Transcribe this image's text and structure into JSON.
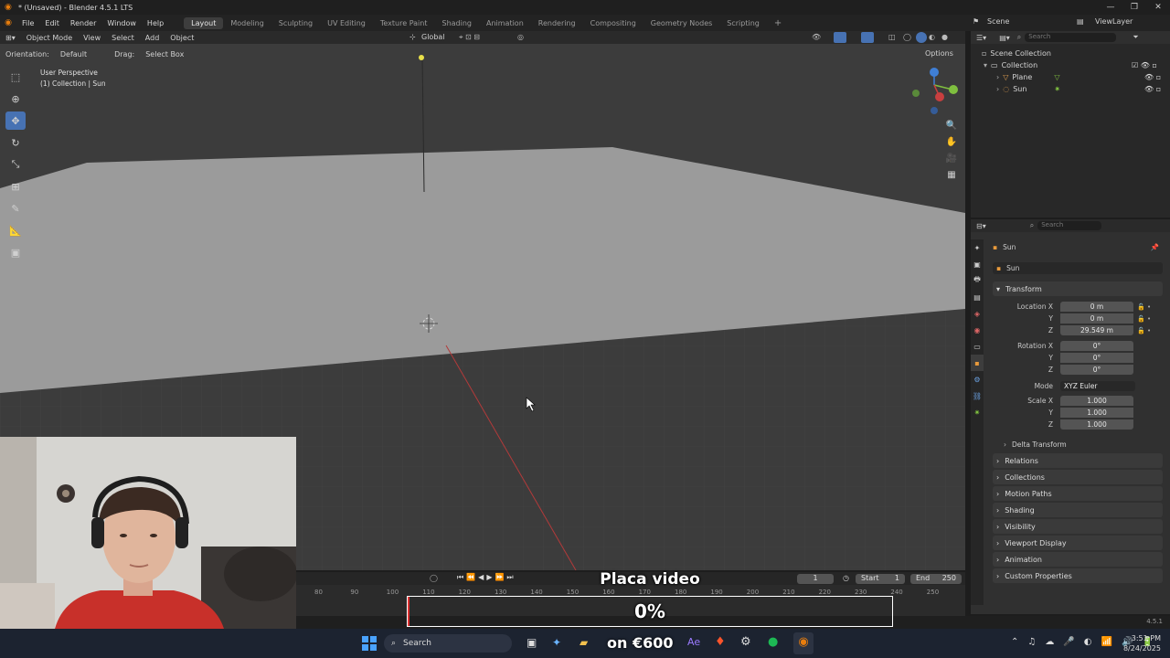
{
  "window": {
    "title": "* (Unsaved) - Blender 4.5.1 LTS",
    "minimize": "—",
    "restore": "❐",
    "close": "✕"
  },
  "menu": {
    "items": [
      "File",
      "Edit",
      "Render",
      "Window",
      "Help"
    ]
  },
  "workspaces": {
    "tabs": [
      "Layout",
      "Modeling",
      "Sculpting",
      "UV Editing",
      "Texture Paint",
      "Shading",
      "Animation",
      "Rendering",
      "Compositing",
      "Geometry Nodes",
      "Scripting"
    ],
    "active": "Layout",
    "add": "+"
  },
  "scene": {
    "label": "Scene",
    "viewlayer": "ViewLayer"
  },
  "viewport_header": {
    "mode": "Object Mode",
    "menus": [
      "View",
      "Select",
      "Add",
      "Object"
    ],
    "orientation_label": "Global"
  },
  "tool_header": {
    "orientation_label": "Orientation:",
    "orientation_value": "Default",
    "drag_label": "Drag:",
    "drag_value": "Select Box",
    "options": "Options"
  },
  "viewport_info": {
    "line1": "User Perspective",
    "line2": "(1) Collection | Sun"
  },
  "gizmo": {
    "x": "X",
    "y": "Y",
    "z": "Z"
  },
  "outliner": {
    "search_placeholder": "Search",
    "root": "Scene Collection",
    "collection": "Collection",
    "objects": [
      "Plane",
      "Sun"
    ]
  },
  "properties": {
    "search_placeholder": "Search",
    "object_name": "Sun",
    "data_name": "Sun",
    "transform_label": "Transform",
    "location_label": "Location X",
    "loc_x": "0 m",
    "loc_y": "0 m",
    "loc_z": "29.549 m",
    "rotation_label": "Rotation X",
    "rot_x": "0°",
    "rot_y": "0°",
    "rot_z": "0°",
    "mode_label": "Mode",
    "mode_value": "XYZ Euler",
    "scale_label": "Scale X",
    "scale_x": "1.000",
    "scale_y": "1.000",
    "scale_z": "1.000",
    "axis_y": "Y",
    "axis_z": "Z",
    "delta": "Delta Transform",
    "panels": [
      "Relations",
      "Collections",
      "Motion Paths",
      "Shading",
      "Visibility",
      "Viewport Display",
      "Animation",
      "Custom Properties"
    ]
  },
  "timeline": {
    "current_frame": "1",
    "start_label": "Start",
    "start": "1",
    "end_label": "End",
    "end": "250",
    "ticks": [
      "80",
      "90",
      "100",
      "110",
      "120",
      "130",
      "140",
      "150",
      "160",
      "170",
      "180",
      "190",
      "200",
      "210",
      "220",
      "230",
      "240",
      "250"
    ]
  },
  "overlay": {
    "title": "Placa video",
    "progress_text": "0%",
    "progress": 0.0
  },
  "statusbar": {
    "version": "4.5.1"
  },
  "taskbar": {
    "search": "Search",
    "promo": "on €600",
    "time": "3:51 PM",
    "date": "8/24/2025"
  },
  "colors": {
    "accent": "#4772b3",
    "x_axis": "#c83f3f",
    "y_axis": "#7fbf3f",
    "z_axis": "#3f7fd6",
    "plane": "#9b9b9b"
  }
}
